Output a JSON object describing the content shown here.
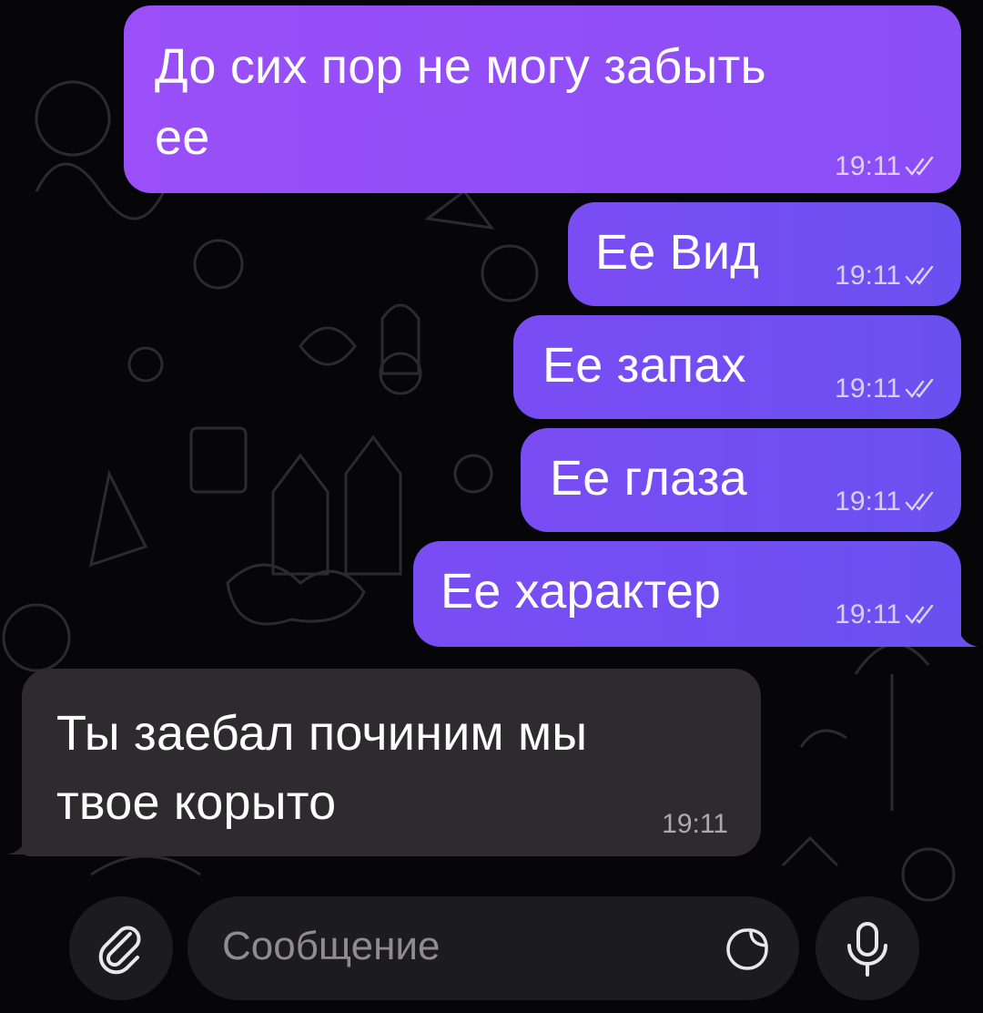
{
  "messages": [
    {
      "text_line1": "До сих пор не могу забыть",
      "text_line2": "ее",
      "time": "19:11",
      "direction": "outgoing",
      "read": true
    },
    {
      "text": "Ее Вид",
      "time": "19:11",
      "direction": "outgoing",
      "read": true
    },
    {
      "text": "Ее запах",
      "time": "19:11",
      "direction": "outgoing",
      "read": true
    },
    {
      "text": "Ее глаза",
      "time": "19:11",
      "direction": "outgoing",
      "read": true
    },
    {
      "text": "Ее характер",
      "time": "19:11",
      "direction": "outgoing",
      "read": true
    },
    {
      "text_line1": "Ты заебал починим мы",
      "text_line2": "твое корыто",
      "time": "19:11",
      "direction": "incoming"
    }
  ],
  "composer": {
    "placeholder": "Сообщение",
    "attach_icon": "paperclip-icon",
    "sticker_icon": "sticker-icon",
    "mic_icon": "microphone-icon"
  },
  "colors": {
    "outgoing_top": "#9a4ff8",
    "outgoing": "#6a50f0",
    "incoming": "#2d2b2e",
    "background": "#060608"
  }
}
